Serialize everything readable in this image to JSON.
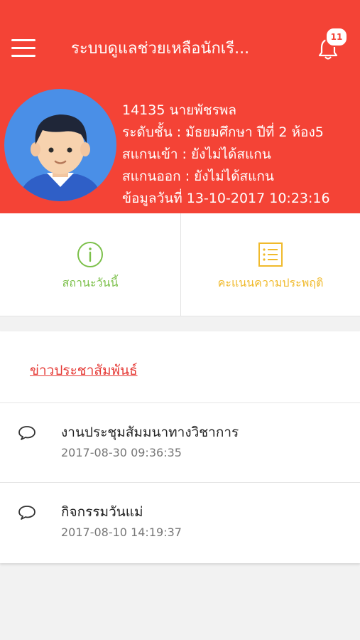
{
  "header": {
    "title": "ระบบดูแลช่วยเหลือนักเรี...",
    "notification_count": "11",
    "background_color": "#f44336"
  },
  "profile": {
    "id_name": "14135 นายพัชรพล",
    "level": "ระดับชั้น : มัธยมศึกษา ปีที่ 2 ห้อง5",
    "scan_in": "สแกนเข้า :    ยังไม่ได้สแกน",
    "scan_out": "สแกนออก :    ยังไม่ได้สแกน",
    "data_date": "ข้อมูลวันที่ 13-10-2017 10:23:16"
  },
  "tiles": {
    "status_label": "สถานะวันนี้",
    "status_icon": "info-circle-icon",
    "score_label": "คะแนนความประพฤติ",
    "score_icon": "list-icon"
  },
  "news": {
    "header": "ข่าวประชาสัมพันธ์",
    "items": [
      {
        "title": "งานประชุมสัมมนาทางวิชาการ",
        "date": "2017-08-30  09:36:35"
      },
      {
        "title": "กิจกรรมวันแม่",
        "date": "2017-08-10  14:19:37"
      }
    ]
  },
  "colors": {
    "accent": "#f44336",
    "green": "#7cc04a",
    "yellow": "#f0ba2c"
  }
}
